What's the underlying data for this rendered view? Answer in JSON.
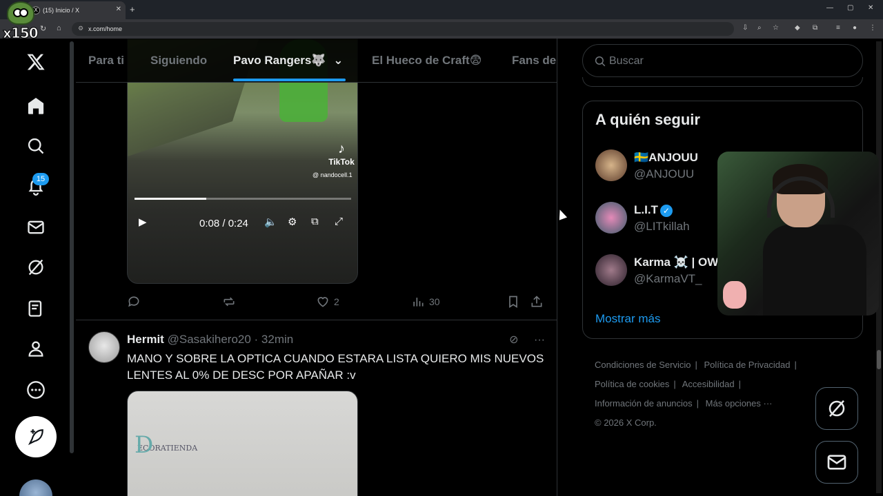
{
  "browser": {
    "tab_title": "(15) Inicio / X",
    "url": "x.com/home"
  },
  "overlay": {
    "badge_text": "x150"
  },
  "sidebar": {
    "notifications_count": "15",
    "items": [
      "x-logo",
      "home",
      "explore",
      "notifications",
      "messages",
      "grok",
      "lists",
      "profile",
      "more"
    ]
  },
  "feed_tabs": {
    "items": [
      {
        "label": "Para ti"
      },
      {
        "label": "Siguiendo"
      },
      {
        "label": "Pavo Rangers🐺"
      },
      {
        "label": "El Hueco de Craft😨"
      },
      {
        "label": "Fans de"
      }
    ],
    "active_index": 2
  },
  "post1": {
    "tiktok_label": "TikTok",
    "tiktok_user": "@ nandocell.1",
    "time_display": "0:08 / 0:24",
    "progress": 0.33,
    "likes": "2",
    "views": "30"
  },
  "post2": {
    "name": "Hermit",
    "handle": "@Sasakihero20",
    "time": "· 32min",
    "text": "MANO Y SOBRE LA OPTICA CUANDO ESTARA LISTA QUIERO MIS NUEVOS LENTES AL 0% DE DESC POR APAÑAR :v",
    "image_logo": "ECORATIENDA"
  },
  "right": {
    "search_placeholder": "Buscar",
    "who_to_follow_title": "A quién seguir",
    "suggestions": [
      {
        "name": "🇸🇪ANJOUU",
        "handle": "@ANJOUU"
      },
      {
        "name": "L.I.T",
        "handle": "@LITkillah",
        "verified": true
      },
      {
        "name": "Karma ☠️ | OW",
        "handle": "@KarmaVT_"
      }
    ],
    "show_more": "Mostrar más",
    "footer_links": [
      "Condiciones de Servicio",
      "Política de Privacidad",
      "Política de cookies",
      "Accesibilidad",
      "Información de anuncios",
      "Más opciones ···"
    ],
    "copyright": "© 2026 X Corp."
  },
  "colors": {
    "accent": "#1d9bf0",
    "background": "#000000",
    "muted_text": "#71767b",
    "border": "#2f3336"
  }
}
